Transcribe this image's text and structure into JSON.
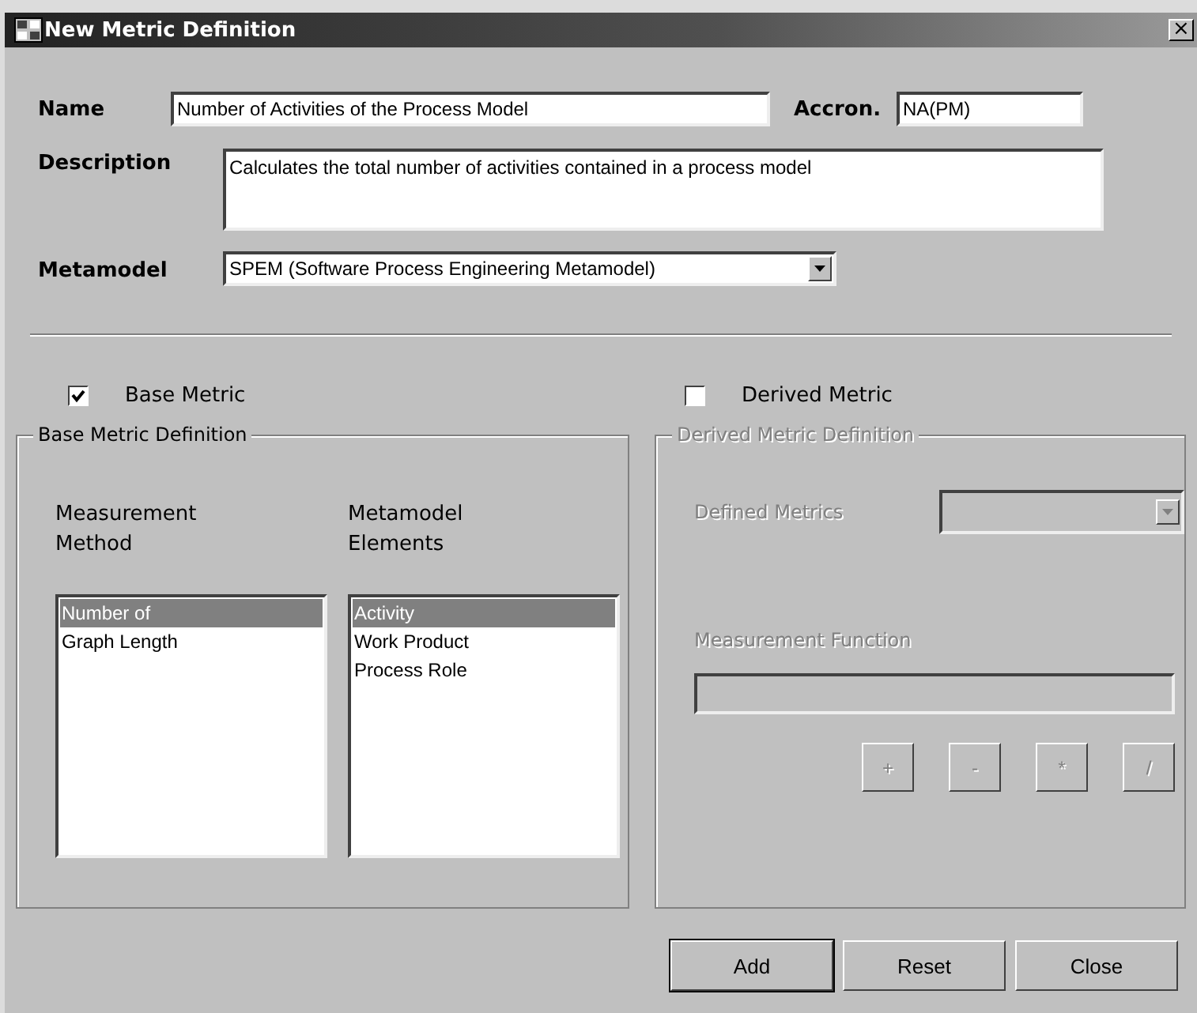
{
  "window": {
    "title": "New Metric Definition",
    "close_glyph": "×"
  },
  "name": {
    "label": "Name",
    "value": "Number of Activities of the Process Model"
  },
  "acronym": {
    "label": "Accron.",
    "value": "NA(PM)"
  },
  "description": {
    "label": "Description",
    "value": "Calculates the total number of activities contained in a process model"
  },
  "metamodel": {
    "label": "Metamodel",
    "value": "SPEM (Software Process Engineering Metamodel)"
  },
  "base_metric": {
    "label": "Base Metric",
    "checked": true
  },
  "derived_metric": {
    "label": "Derived Metric",
    "checked": false
  },
  "base_definition": {
    "title": "Base Metric Definition",
    "lists": [
      {
        "label_lines": [
          "Measurement",
          "Method"
        ],
        "items": [
          {
            "text": "Number of",
            "selected": true
          },
          {
            "text": "Graph Length",
            "selected": false
          }
        ]
      },
      {
        "label_lines": [
          "Metamodel",
          "Elements"
        ],
        "items": [
          {
            "text": "Activity",
            "selected": true
          },
          {
            "text": "Work Product",
            "selected": false
          },
          {
            "text": "Process Role",
            "selected": false
          }
        ]
      }
    ]
  },
  "derived_definition": {
    "title": "Derived Metric Definition",
    "disabled": true,
    "defined_metrics_label": "Defined Metrics",
    "function_label": "Measurement Function",
    "operators": [
      "+",
      "-",
      "*",
      "/"
    ]
  },
  "buttons": [
    {
      "label": "Add",
      "default": true
    },
    {
      "label": "Reset",
      "default": false
    },
    {
      "label": "Close",
      "default": false
    }
  ]
}
